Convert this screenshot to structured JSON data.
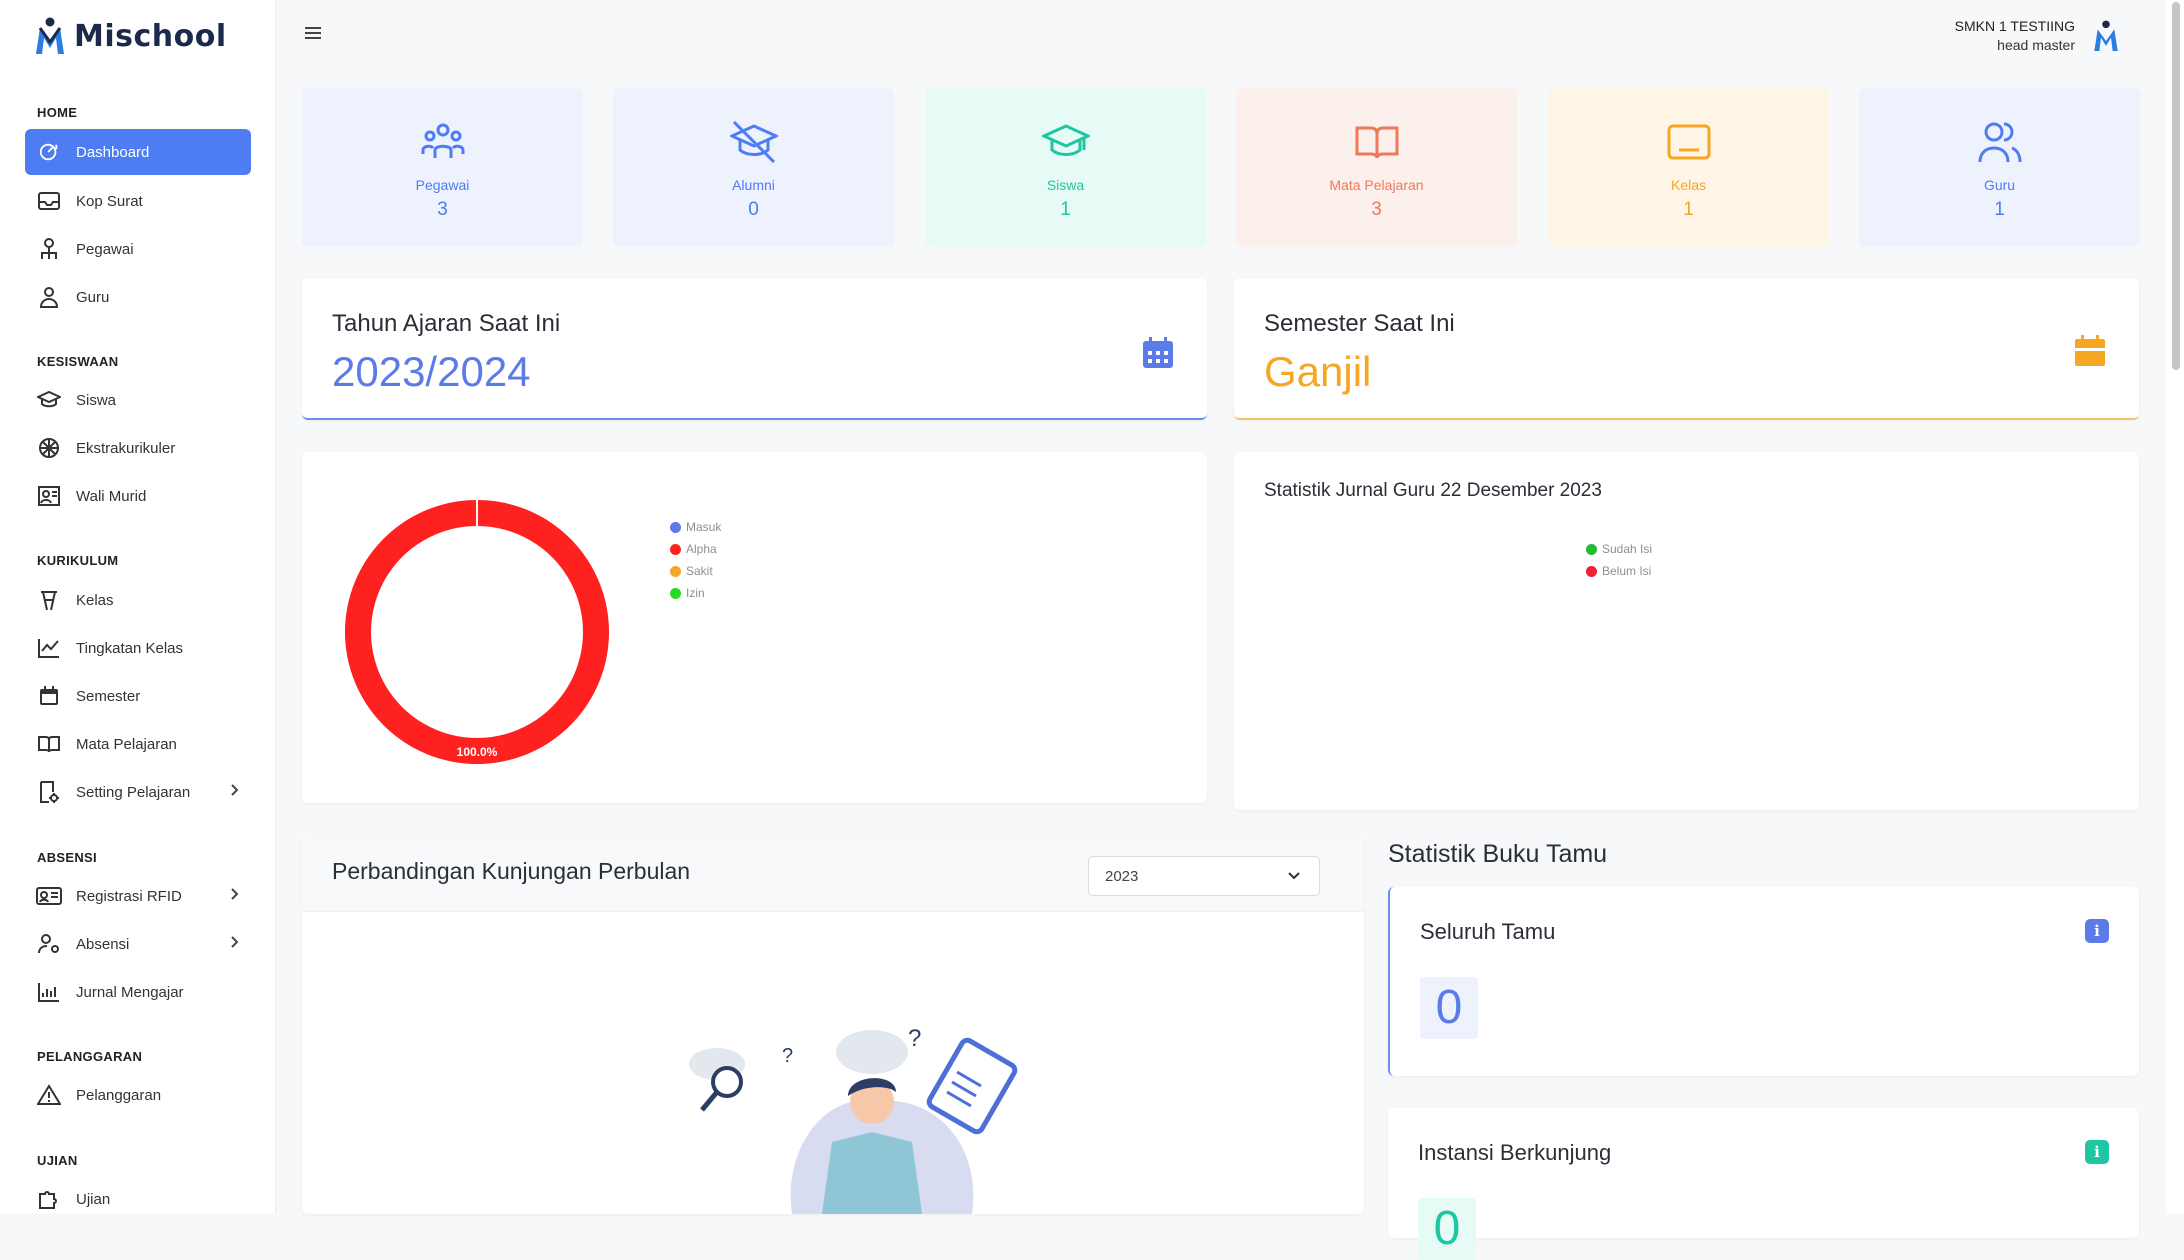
{
  "app": {
    "logo_text": "Mischool"
  },
  "user": {
    "school": "SMKN 1 TESTIING",
    "role": "head master"
  },
  "sidebar": {
    "sections": [
      {
        "label": "HOME",
        "items": [
          {
            "label": "Dashboard",
            "icon": "dashboard-icon",
            "active": true
          },
          {
            "label": "Kop Surat",
            "icon": "mail-icon"
          },
          {
            "label": "Pegawai",
            "icon": "employee-icon"
          },
          {
            "label": "Guru",
            "icon": "teacher-icon"
          }
        ]
      },
      {
        "label": "KESISWAAN",
        "items": [
          {
            "label": "Siswa",
            "icon": "graduation-cap-icon"
          },
          {
            "label": "Ekstrakurikuler",
            "icon": "ball-icon"
          },
          {
            "label": "Wali Murid",
            "icon": "parent-icon"
          }
        ]
      },
      {
        "label": "KURIKULUM",
        "items": [
          {
            "label": "Kelas",
            "icon": "chair-icon"
          },
          {
            "label": "Tingkatan Kelas",
            "icon": "level-chart-icon"
          },
          {
            "label": "Semester",
            "icon": "calendar-icon"
          },
          {
            "label": "Mata Pelajaran",
            "icon": "book-icon"
          },
          {
            "label": "Setting Pelajaran",
            "icon": "settings-book-icon"
          }
        ]
      },
      {
        "label": "ABSENSI",
        "items": [
          {
            "label": "Registrasi RFID",
            "icon": "id-card-icon"
          },
          {
            "label": "Absensi",
            "icon": "user-gear-icon"
          },
          {
            "label": "Jurnal Mengajar",
            "icon": "chart-icon"
          }
        ]
      },
      {
        "label": "PELANGGARAN",
        "items": [
          {
            "label": "Pelanggaran",
            "icon": "warning-icon"
          }
        ]
      },
      {
        "label": "UJIAN",
        "items": [
          {
            "label": "Ujian",
            "icon": "puzzle-icon"
          }
        ]
      }
    ]
  },
  "stats": [
    {
      "label": "Pegawai",
      "value": "3",
      "color": "#4e7cf2",
      "bg": "#edf2fd",
      "icon": "users-icon"
    },
    {
      "label": "Alumni",
      "value": "0",
      "color": "#4e7cf2",
      "bg": "#edf2fd",
      "icon": "graduate-off-icon"
    },
    {
      "label": "Siswa",
      "value": "1",
      "color": "#1fc6a2",
      "bg": "#e6fbf5",
      "icon": "graduation-cap-icon"
    },
    {
      "label": "Mata Pelajaran",
      "value": "3",
      "color": "#f0785a",
      "bg": "#fcf0ec",
      "icon": "book-open-icon"
    },
    {
      "label": "Kelas",
      "value": "1",
      "color": "#f5a623",
      "bg": "#fef5e7",
      "icon": "screen-icon"
    },
    {
      "label": "Guru",
      "value": "1",
      "color": "#4e7cf2",
      "bg": "#edf2fd",
      "icon": "user-group-icon"
    }
  ],
  "tahun_ajaran": {
    "title": "Tahun Ajaran Saat Ini",
    "value": "2023/2024",
    "color": "#5b7ce8"
  },
  "semester": {
    "title": "Semester Saat Ini",
    "value": "Ganjil",
    "color": "#f5a623"
  },
  "attendance_chart": {
    "legend": [
      {
        "label": "Masuk",
        "color": "#5b7ce8"
      },
      {
        "label": "Alpha",
        "color": "#ff2020"
      },
      {
        "label": "Sakit",
        "color": "#f5a623"
      },
      {
        "label": "Izin",
        "color": "#22dd22"
      }
    ]
  },
  "jurnal": {
    "title": "Statistik Jurnal Guru 22 Desember 2023",
    "legend": [
      {
        "label": "Sudah Isi",
        "color": "#22bb33"
      },
      {
        "label": "Belum Isi",
        "color": "#ee2233"
      }
    ]
  },
  "kunjungan": {
    "title": "Perbandingan Kunjungan Perbulan",
    "year": "2023"
  },
  "buku_tamu": {
    "title": "Statistik Buku Tamu",
    "cards": [
      {
        "label": "Seluruh Tamu",
        "value": "0",
        "color": "#5b7ce8"
      },
      {
        "label": "Instansi Berkunjung",
        "value": "0",
        "color": "#1fc6a2"
      }
    ]
  },
  "chart_data": [
    {
      "type": "pie",
      "categories": [
        "Masuk",
        "Alpha",
        "Sakit",
        "Izin"
      ],
      "values": [
        0,
        100,
        0,
        0
      ],
      "data_labels": [
        "",
        "100.0%",
        "",
        ""
      ],
      "colors": [
        "#5b7ce8",
        "#ff2020",
        "#f5a623",
        "#22dd22"
      ],
      "donut": true,
      "legend_position": "right"
    },
    {
      "type": "pie",
      "title": "Statistik Jurnal Guru 22 Desember 2023",
      "categories": [
        "Sudah Isi",
        "Belum Isi"
      ],
      "values": [
        0,
        0
      ],
      "colors": [
        "#22bb33",
        "#ee2233"
      ],
      "legend_position": "top"
    }
  ]
}
